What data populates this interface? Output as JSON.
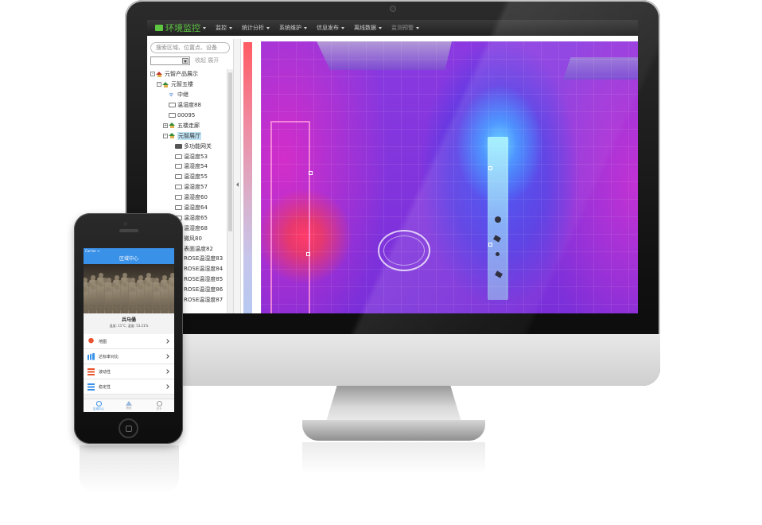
{
  "navbar": {
    "brand": "环境监控",
    "items": [
      "监控",
      "统计分析",
      "系统维护",
      "信息发布",
      "离线数据",
      "监测预警"
    ]
  },
  "left_panel": {
    "search_placeholder": "搜索区域、位置点、设备",
    "collapse_expand": "收起 展开",
    "tree": [
      {
        "label": "元智产品展示",
        "level": 0,
        "icon": "house-red-icon",
        "toggle": "⊟"
      },
      {
        "label": "元智五楼",
        "level": 1,
        "icon": "house-green-icon",
        "toggle": "⊟"
      },
      {
        "label": "中继",
        "level": 2,
        "icon": "antenna-icon",
        "toggle": ""
      },
      {
        "label": "温湿度88",
        "level": 2,
        "icon": "folder-icon",
        "toggle": ""
      },
      {
        "label": "00095",
        "level": 2,
        "icon": "folder-icon",
        "toggle": ""
      },
      {
        "label": "五楼走廊",
        "level": 2,
        "icon": "house-green-icon",
        "toggle": "⊞"
      },
      {
        "label": "元智展厅",
        "level": 2,
        "icon": "house-green-icon",
        "toggle": "⊟",
        "selected": true
      },
      {
        "label": "多功能网关",
        "level": 3,
        "icon": "gateway-icon",
        "toggle": ""
      },
      {
        "label": "温湿度53",
        "level": 3,
        "icon": "folder-icon",
        "toggle": ""
      },
      {
        "label": "温湿度54",
        "level": 3,
        "icon": "folder-icon",
        "toggle": ""
      },
      {
        "label": "温湿度55",
        "level": 3,
        "icon": "folder-icon",
        "toggle": ""
      },
      {
        "label": "温湿度57",
        "level": 3,
        "icon": "folder-icon",
        "toggle": ""
      },
      {
        "label": "温湿度60",
        "level": 3,
        "icon": "folder-icon",
        "toggle": ""
      },
      {
        "label": "温湿度64",
        "level": 3,
        "icon": "folder-icon",
        "toggle": ""
      },
      {
        "label": "温湿度65",
        "level": 3,
        "icon": "folder-icon",
        "toggle": ""
      },
      {
        "label": "温湿度68",
        "level": 3,
        "icon": "folder-icon",
        "toggle": ""
      },
      {
        "label": "微风80",
        "level": 3,
        "icon": "folder-icon",
        "toggle": ""
      },
      {
        "label": "表面温度82",
        "level": 3,
        "icon": "folder-icon",
        "toggle": ""
      },
      {
        "label": "ROSE温湿度83",
        "level": 3,
        "icon": "folder-icon",
        "toggle": ""
      },
      {
        "label": "ROSE温湿度84",
        "level": 3,
        "icon": "folder-icon",
        "toggle": ""
      },
      {
        "label": "ROSE温湿度85",
        "level": 3,
        "icon": "folder-icon",
        "toggle": ""
      },
      {
        "label": "ROSE温湿度86",
        "level": 3,
        "icon": "folder-icon",
        "toggle": ""
      },
      {
        "label": "ROSE温湿度87",
        "level": 3,
        "icon": "folder-icon",
        "toggle": ""
      }
    ]
  },
  "phone": {
    "status": {
      "carrier": "Carrier ᯤ",
      "time": "",
      "battery": ""
    },
    "header": "区域中心",
    "title": "兵马俑",
    "subtitle": "温度: 11°C, 湿度: 53.21%",
    "list": [
      {
        "label": "地图",
        "icon": "map-pin-icon"
      },
      {
        "label": "达标率对比",
        "icon": "bar-chart-icon"
      },
      {
        "label": "波动性",
        "icon": "fluctuation-icon"
      },
      {
        "label": "稳定性",
        "icon": "stability-icon"
      }
    ],
    "tabs": [
      {
        "label": "区域中心",
        "active": true
      },
      {
        "label": "首页",
        "active": false
      },
      {
        "label": "关于",
        "active": false
      }
    ]
  },
  "colors": {
    "brand_green": "#5ec742",
    "phone_blue": "#3a91e8",
    "heat_hot": "#ff3c6a",
    "heat_cool": "#5fd1ff"
  }
}
